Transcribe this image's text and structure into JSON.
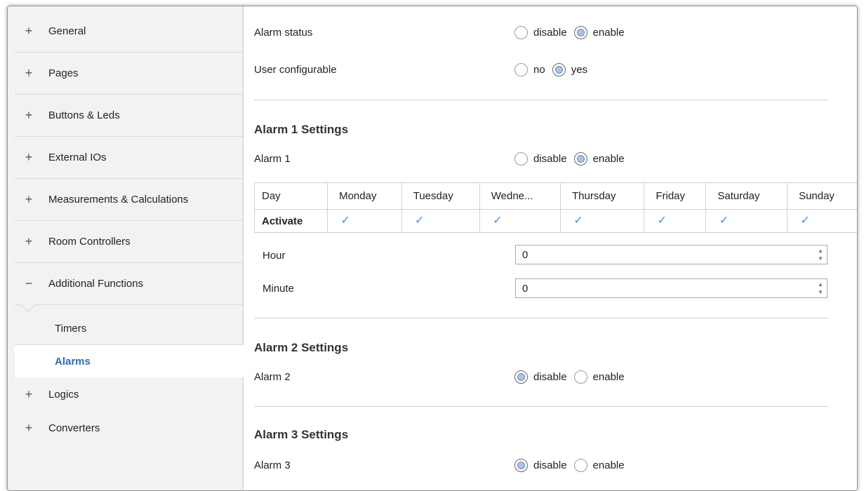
{
  "sidebar": {
    "items": [
      {
        "symbol": "+",
        "label": "General"
      },
      {
        "symbol": "+",
        "label": "Pages"
      },
      {
        "symbol": "+",
        "label": "Buttons & Leds"
      },
      {
        "symbol": "+",
        "label": "External IOs"
      },
      {
        "symbol": "+",
        "label": "Measurements & Calculations"
      },
      {
        "symbol": "+",
        "label": "Room Controllers"
      },
      {
        "symbol": "−",
        "label": "Additional Functions"
      }
    ],
    "sub_items": [
      {
        "label": "Timers"
      },
      {
        "label": "Alarms"
      }
    ],
    "bottom_items": [
      {
        "symbol": "+",
        "label": "Logics"
      },
      {
        "symbol": "+",
        "label": "Converters"
      }
    ]
  },
  "main": {
    "alarm_status": {
      "label": "Alarm status",
      "options": [
        "disable",
        "enable"
      ],
      "selected": "enable"
    },
    "user_configurable": {
      "label": "User configurable",
      "options": [
        "no",
        "yes"
      ],
      "selected": "yes"
    },
    "alarm1": {
      "title": "Alarm 1 Settings",
      "label": "Alarm 1",
      "options": [
        "disable",
        "enable"
      ],
      "selected": "enable",
      "table": {
        "headers": [
          "Day",
          "Monday",
          "Tuesday",
          "Wedne...",
          "Thursday",
          "Friday",
          "Saturday",
          "Sunday"
        ],
        "row_label": "Activate",
        "checked": [
          true,
          true,
          true,
          true,
          true,
          true,
          true
        ],
        "check_glyph": "✓"
      },
      "hour": {
        "label": "Hour",
        "value": "0"
      },
      "minute": {
        "label": "Minute",
        "value": "0"
      }
    },
    "alarm2": {
      "title": "Alarm 2 Settings",
      "label": "Alarm 2",
      "options": [
        "disable",
        "enable"
      ],
      "selected": "disable"
    },
    "alarm3": {
      "title": "Alarm 3 Settings",
      "label": "Alarm 3",
      "options": [
        "disable",
        "enable"
      ],
      "selected": "disable"
    }
  },
  "spinner": {
    "up": "▲",
    "down": "▼"
  },
  "colors": {
    "accent": "#2a6ebb",
    "check": "#4a90d9",
    "sidebar_bg": "#f2f2f2"
  }
}
